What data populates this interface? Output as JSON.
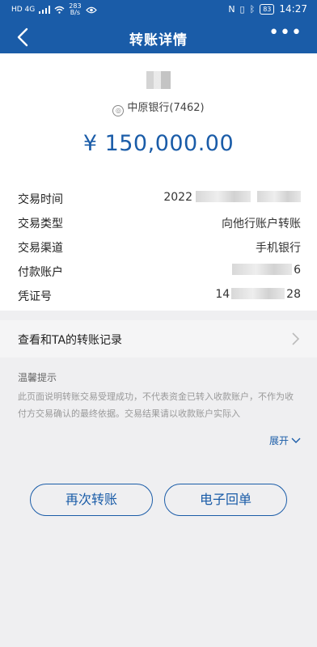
{
  "status_bar": {
    "left_text": "HD 4G",
    "speed_value": "283",
    "speed_unit": "B/s",
    "battery": "83",
    "time": "14:27"
  },
  "nav": {
    "title": "转账详情",
    "more_label": "•••"
  },
  "transfer": {
    "bank": "中原银行(7462)",
    "amount": "¥ 150,000.00"
  },
  "details": [
    {
      "label": "交易时间",
      "value": "2022"
    },
    {
      "label": "交易类型",
      "value": "向他行账户转账"
    },
    {
      "label": "交易渠道",
      "value": "手机银行"
    },
    {
      "label": "付款账户",
      "value": "6"
    },
    {
      "label": "凭证号",
      "value_prefix": "14",
      "value_suffix": "28"
    }
  ],
  "history_link": "查看和TA的转账记录",
  "tips": {
    "title": "温馨提示",
    "body": "此页面说明转账交易受理成功，不代表资金已转入收款账户，不作为收付方交易确认的最终依据。交易结果请以收款账户实际入",
    "expand_label": "展开"
  },
  "buttons": {
    "again_label": "再次转账",
    "receipt_label": "电子回单"
  },
  "colors": {
    "brand": "#1a5ca8",
    "background": "#efeff1"
  }
}
